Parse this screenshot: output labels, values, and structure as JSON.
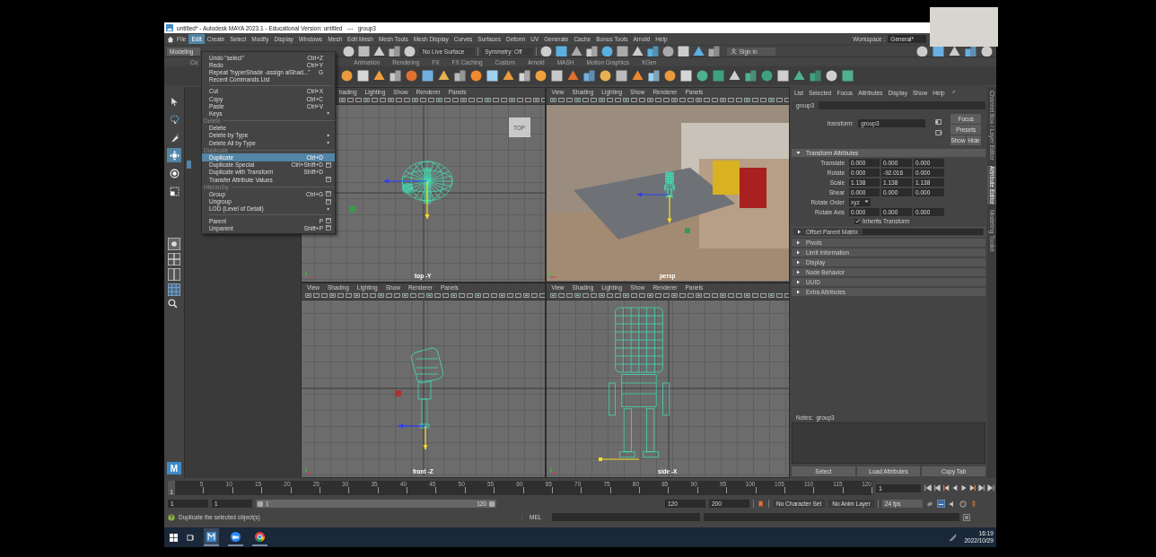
{
  "window": {
    "title": "untitled* - Autodesk MAYA 2023.1 - Educational Version: untitled   ---   group3"
  },
  "menu_bar": {
    "items": [
      {
        "label": "File",
        "selected": false
      },
      {
        "label": "Edit",
        "selected": true
      },
      {
        "label": "Create",
        "selected": false
      },
      {
        "label": "Select",
        "selected": false
      },
      {
        "label": "Modify",
        "selected": false
      },
      {
        "label": "Display",
        "selected": false
      },
      {
        "label": "Windows",
        "selected": false
      },
      {
        "label": "Mesh",
        "selected": false
      },
      {
        "label": "Edit Mesh",
        "selected": false
      },
      {
        "label": "Mesh Tools",
        "selected": false
      },
      {
        "label": "Mesh Display",
        "selected": false
      },
      {
        "label": "Curves",
        "selected": false
      },
      {
        "label": "Surfaces",
        "selected": false
      },
      {
        "label": "Deform",
        "selected": false
      },
      {
        "label": "UV",
        "selected": false
      },
      {
        "label": "Generate",
        "selected": false
      },
      {
        "label": "Cache",
        "selected": false
      },
      {
        "label": "Bonus Tools",
        "selected": false
      },
      {
        "label": "Arnold",
        "selected": false
      },
      {
        "label": "Help",
        "selected": false
      }
    ],
    "workspace_label": "Workspace :",
    "workspace": "General*"
  },
  "status_line": {
    "mode": "Modeling",
    "live_surface": "No Live Surface",
    "symmetry": "Symmetry: Off",
    "sign_in": "Sign in"
  },
  "shelf": {
    "tabs": [
      {
        "label": "Cu",
        "selected": false
      },
      {
        "label": "Animation",
        "selected": false
      },
      {
        "label": "Rendering",
        "selected": false
      },
      {
        "label": "FX",
        "selected": false
      },
      {
        "label": "FX Caching",
        "selected": false
      },
      {
        "label": "Custom",
        "selected": false
      },
      {
        "label": "Arnold",
        "selected": false
      },
      {
        "label": "MASH",
        "selected": false
      },
      {
        "label": "Motion Graphics",
        "selected": false
      },
      {
        "label": "XGen",
        "selected": false
      }
    ]
  },
  "edit_menu": {
    "items": [
      {
        "kind": "item",
        "label": "Undo \"select\"",
        "shortcut": "Ctrl+Z",
        "submenu": false,
        "option_box": false,
        "selected": false
      },
      {
        "kind": "item",
        "label": "Redo",
        "shortcut": "Ctrl+Y",
        "submenu": false,
        "option_box": false,
        "selected": false
      },
      {
        "kind": "item",
        "label": "Repeat \"hyperShade -assign aiShad...\"",
        "shortcut": "G",
        "submenu": false,
        "option_box": false,
        "selected": false
      },
      {
        "kind": "item",
        "label": "Recent Commands List",
        "submenu": false,
        "option_box": false,
        "selected": false
      },
      {
        "kind": "separator"
      },
      {
        "kind": "item",
        "label": "Cut",
        "shortcut": "Ctrl+X",
        "submenu": false,
        "option_box": false,
        "selected": false
      },
      {
        "kind": "item",
        "label": "Copy",
        "shortcut": "Ctrl+C",
        "submenu": false,
        "option_box": false,
        "selected": false
      },
      {
        "kind": "item",
        "label": "Paste",
        "shortcut": "Ctrl+V",
        "submenu": false,
        "option_box": false,
        "selected": false
      },
      {
        "kind": "item",
        "label": "Keys",
        "submenu": true,
        "option_box": false,
        "selected": false
      },
      {
        "kind": "section",
        "label": "Delete"
      },
      {
        "kind": "item",
        "label": "Delete",
        "submenu": false,
        "option_box": false,
        "selected": false
      },
      {
        "kind": "item",
        "label": "Delete by Type",
        "submenu": true,
        "option_box": false,
        "selected": false
      },
      {
        "kind": "item",
        "label": "Delete All by Type",
        "submenu": true,
        "option_box": false,
        "selected": false
      },
      {
        "kind": "section",
        "label": "Duplicate"
      },
      {
        "kind": "item",
        "label": "Duplicate",
        "shortcut": "Ctrl+D",
        "submenu": false,
        "option_box": false,
        "selected": true
      },
      {
        "kind": "item",
        "label": "Duplicate Special",
        "shortcut": "Ctrl+Shift+D",
        "submenu": false,
        "option_box": true,
        "selected": false
      },
      {
        "kind": "item",
        "label": "Duplicate with Transform",
        "shortcut": "Shift+D",
        "submenu": false,
        "option_box": false,
        "selected": false
      },
      {
        "kind": "item",
        "label": "Transfer Attribute Values",
        "submenu": false,
        "option_box": true,
        "selected": false
      },
      {
        "kind": "section",
        "label": "Hierarchy"
      },
      {
        "kind": "item",
        "label": "Group",
        "shortcut": "Ctrl+G",
        "submenu": false,
        "option_box": true,
        "selected": false
      },
      {
        "kind": "item",
        "label": "Ungroup",
        "submenu": false,
        "option_box": true,
        "selected": false
      },
      {
        "kind": "item",
        "label": "LOD (Level of Detail)",
        "submenu": true,
        "option_box": false,
        "selected": false
      },
      {
        "kind": "separator"
      },
      {
        "kind": "item",
        "label": "Parent",
        "shortcut": "P",
        "submenu": false,
        "option_box": true,
        "selected": false
      },
      {
        "kind": "item",
        "label": "Unparent",
        "shortcut": "Shift+P",
        "submenu": false,
        "option_box": true,
        "selected": false
      }
    ]
  },
  "toolbox": {
    "tools": [
      {
        "kind": "select",
        "selected": false
      },
      {
        "kind": "lasso",
        "selected": false
      },
      {
        "kind": "paint",
        "selected": false
      },
      {
        "kind": "move",
        "selected": true
      },
      {
        "kind": "rotate",
        "selected": false
      },
      {
        "kind": "scale",
        "selected": false
      }
    ],
    "logo": "M"
  },
  "viewports": [
    {
      "kind": "top",
      "label": "top -Y",
      "menus": [
        "hading",
        "Lighting",
        "Show",
        "Renderer",
        "Panels"
      ],
      "view_cube": "TOP"
    },
    {
      "kind": "persp",
      "label": "persp",
      "menus": [
        "View",
        "Shading",
        "Lighting",
        "Show",
        "Renderer",
        "Panels"
      ]
    },
    {
      "kind": "front",
      "label": "front -Z",
      "menus": [
        "View",
        "Shading",
        "Lighting",
        "Show",
        "Renderer",
        "Panels"
      ]
    },
    {
      "kind": "side",
      "label": "side -X",
      "menus": [
        "View",
        "Shading",
        "Lighting",
        "Show",
        "Renderer",
        "Panels"
      ]
    }
  ],
  "attribute_editor": {
    "menus": [
      "List",
      "Selected",
      "Focus",
      "Attributes",
      "Display",
      "Show",
      "Help"
    ],
    "tab": "group3",
    "node_type": "transform:",
    "node_name": "group3",
    "buttons": [
      "Focus",
      "Presets",
      "Show",
      "Hide"
    ],
    "section": "Transform Attributes",
    "rows": [
      {
        "label": "Translate",
        "values": [
          "0.000",
          "0.000",
          "0.000"
        ]
      },
      {
        "label": "Rotate",
        "values": [
          "0.000",
          "-92.016",
          "0.000"
        ]
      },
      {
        "label": "Scale",
        "values": [
          "1.138",
          "1.138",
          "1.138"
        ]
      },
      {
        "label": "Shear",
        "values": [
          "0.000",
          "0.000",
          "0.000"
        ]
      }
    ],
    "rotate_order_label": "Rotate Order",
    "rotate_order": "xyz",
    "rotate_axis": {
      "label": "Rotate Axis",
      "values": [
        "0.000",
        "0.000",
        "0.000"
      ]
    },
    "inherits_transform": {
      "label": "Inherits Transform",
      "checked": true
    },
    "offset_parent_matrix": "Offset Parent Matrix",
    "collapsed_sections": [
      "Pivots",
      "Limit Information",
      "Display",
      "Node Behavior",
      "UUID",
      "Extra Attributes"
    ],
    "notes": "Notes:  group3",
    "bottom_buttons": [
      "Select",
      "Load Attributes",
      "Copy Tab"
    ],
    "side_tabs": [
      {
        "label": "Channel Box / Layer Editor",
        "selected": false
      },
      {
        "label": "Attribute Editor",
        "selected": true
      },
      {
        "label": "Modeling Toolkit",
        "selected": false
      }
    ]
  },
  "time_slider": {
    "ticks": [
      "5",
      "10",
      "15",
      "20",
      "25",
      "30",
      "35",
      "40",
      "45",
      "50",
      "55",
      "60",
      "65",
      "70",
      "75",
      "80",
      "85",
      "90",
      "95",
      "100",
      "105",
      "110",
      "115",
      "120"
    ],
    "start_marker": "1",
    "current_frame": "1"
  },
  "range_slider": {
    "level": 1,
    "start": "1",
    "range_start": "1",
    "slider_start": "1",
    "slider_end": "120",
    "range_end": "120",
    "end": "200",
    "character_set": "No Character Set",
    "anim_layer": "No Anim Layer",
    "fps": "24 fps"
  },
  "command_line": {
    "help": "Duplicate the selected object(s)",
    "language": "MEL"
  },
  "taskbar": {
    "time": "16:19",
    "date": "2022/10/29"
  }
}
